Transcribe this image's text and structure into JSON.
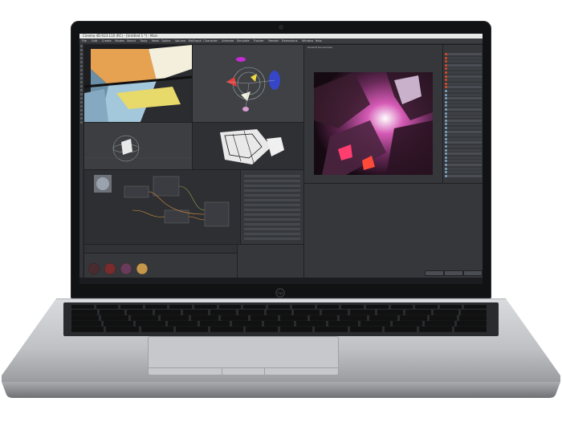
{
  "device": {
    "type": "laptop",
    "brand_logo_icon": "hp-logo-icon",
    "body_color": "#c7c9cc",
    "bezel_color": "#111214"
  },
  "screen_app": {
    "title": "Cinema 4D R23.110 (RC) - [Untitled 1 *] - Main",
    "menus": [
      "File",
      "Edit",
      "Create",
      "Modes",
      "Select",
      "Tools",
      "Mesh",
      "Spline",
      "Volume",
      "MoGraph",
      "Character",
      "Animate",
      "Simulate",
      "Tracker",
      "Render",
      "Extensions",
      "Window",
      "Help"
    ],
    "viewports": [
      "Perspective",
      "Top",
      "Right",
      "Front"
    ],
    "render_view_title": "Redshift RenderView",
    "accent_color": "#e0471f"
  }
}
